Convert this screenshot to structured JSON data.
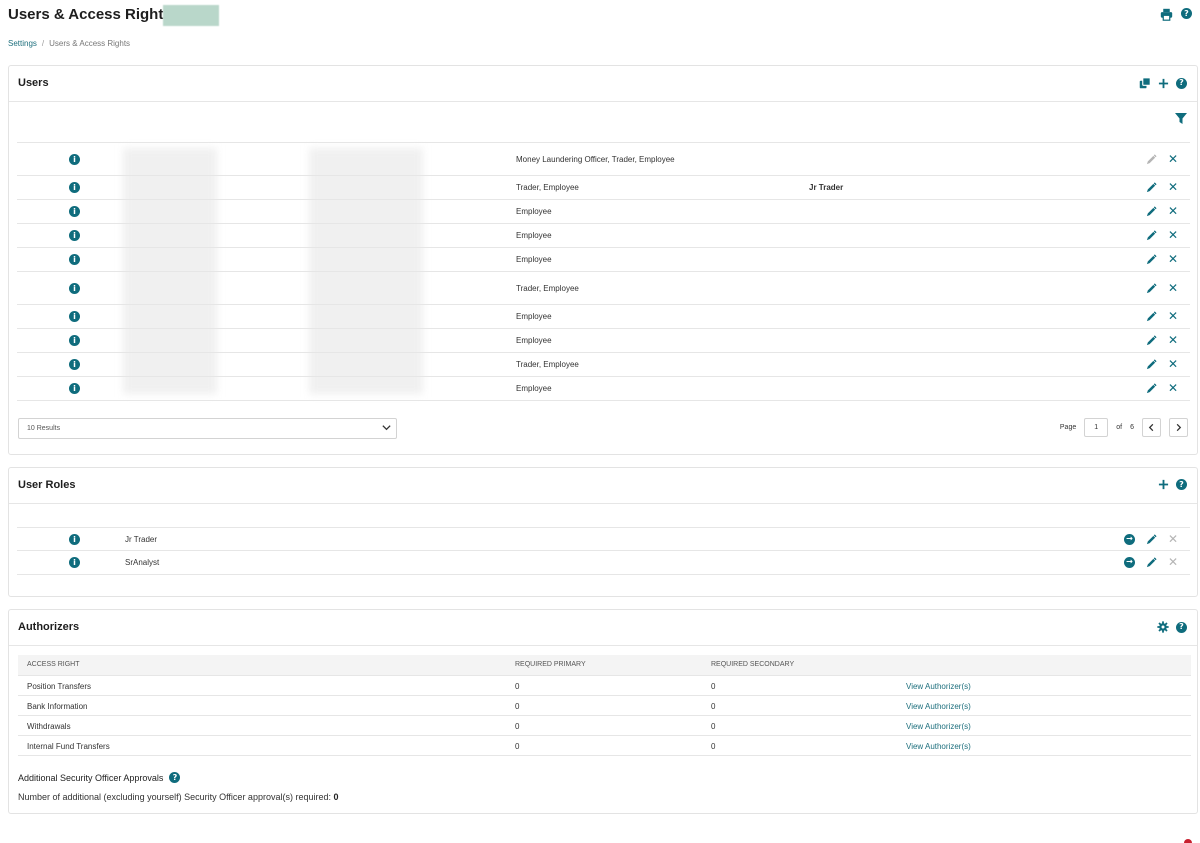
{
  "header": {
    "title": "Users & Access Rights",
    "breadcrumb": {
      "root": "Settings",
      "separator": "/",
      "current": "Users & Access Rights"
    },
    "icons": [
      "print-icon",
      "help-icon"
    ]
  },
  "users": {
    "title": "Users",
    "header_icons": [
      "copy-icon",
      "plus-icon",
      "help-icon"
    ],
    "filter_icon": "filter-icon",
    "rows": [
      {
        "roles": "Money Laundering Officer, Trader, Employee",
        "user_role": "",
        "edit_enabled": false
      },
      {
        "roles": "Trader, Employee",
        "user_role": "Jr Trader",
        "edit_enabled": true
      },
      {
        "roles": "Employee",
        "user_role": "",
        "edit_enabled": true
      },
      {
        "roles": "Employee",
        "user_role": "",
        "edit_enabled": true
      },
      {
        "roles": "Employee",
        "user_role": "",
        "edit_enabled": true
      },
      {
        "roles": "Trader, Employee",
        "user_role": "",
        "edit_enabled": true
      },
      {
        "roles": "Employee",
        "user_role": "",
        "edit_enabled": true
      },
      {
        "roles": "Employee",
        "user_role": "",
        "edit_enabled": true
      },
      {
        "roles": "Trader, Employee",
        "user_role": "",
        "edit_enabled": true
      },
      {
        "roles": "Employee",
        "user_role": "",
        "edit_enabled": true
      }
    ],
    "results_select": "10 Results",
    "pager": {
      "page_label": "Page",
      "page": "1",
      "of_label": "of",
      "total": "6"
    }
  },
  "user_roles": {
    "title": "User Roles",
    "rows": [
      {
        "name": "Jr Trader"
      },
      {
        "name": "SrAnalyst"
      }
    ]
  },
  "authorizers": {
    "title": "Authorizers",
    "columns": [
      "ACCESS RIGHT",
      "REQUIRED PRIMARY",
      "REQUIRED SECONDARY"
    ],
    "rows": [
      {
        "access_right": "Position Transfers",
        "primary": "0",
        "secondary": "0",
        "link": "View Authorizer(s)"
      },
      {
        "access_right": "Bank Information",
        "primary": "0",
        "secondary": "0",
        "link": "View Authorizer(s)"
      },
      {
        "access_right": "Withdrawals",
        "primary": "0",
        "secondary": "0",
        "link": "View Authorizer(s)"
      },
      {
        "access_right": "Internal Fund Transfers",
        "primary": "0",
        "secondary": "0",
        "link": "View Authorizer(s)"
      }
    ],
    "additional_title": "Additional Security Officer Approvals",
    "additional_text": "Number of additional (excluding yourself) Security Officer approval(s) required:",
    "additional_value": "0"
  },
  "colors": {
    "accent": "#0f6c7d",
    "link": "#1d6f7d",
    "disabled": "#b5b5b5"
  }
}
